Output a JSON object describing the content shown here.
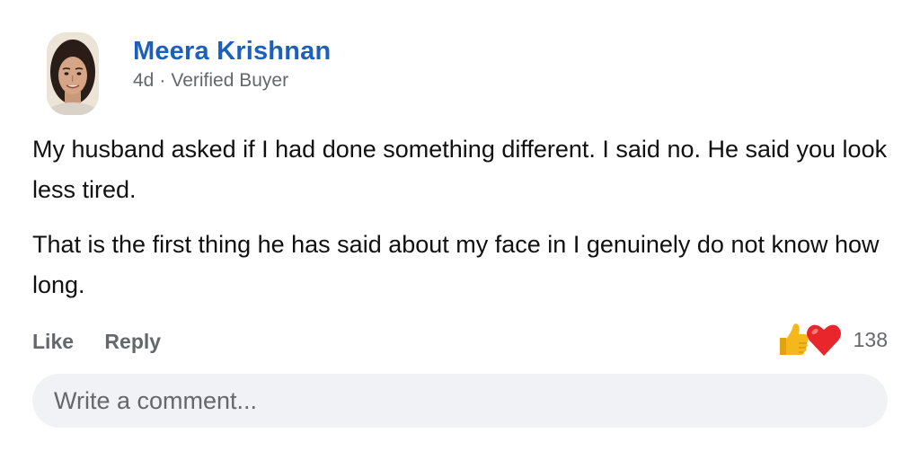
{
  "review": {
    "author": "Meera Krishnan",
    "age": "4d",
    "separator": "·",
    "badge": "Verified Buyer",
    "paragraphs": [
      "My husband asked if I had done something different. I said no. He said you look less tired.",
      "That is the first thing he has said about my face in I genuinely do not know how long."
    ]
  },
  "actions": {
    "like_label": "Like",
    "reply_label": "Reply"
  },
  "reactions": {
    "icons": [
      "thumbs-up-icon",
      "heart-icon"
    ],
    "count": "138"
  },
  "comment": {
    "placeholder": "Write a comment..."
  },
  "colors": {
    "author": "#1d5fc0",
    "meta": "#65676b",
    "comment_bg": "#f0f2f5",
    "heart": "#e8262b",
    "thumb": "#f5b81c"
  }
}
